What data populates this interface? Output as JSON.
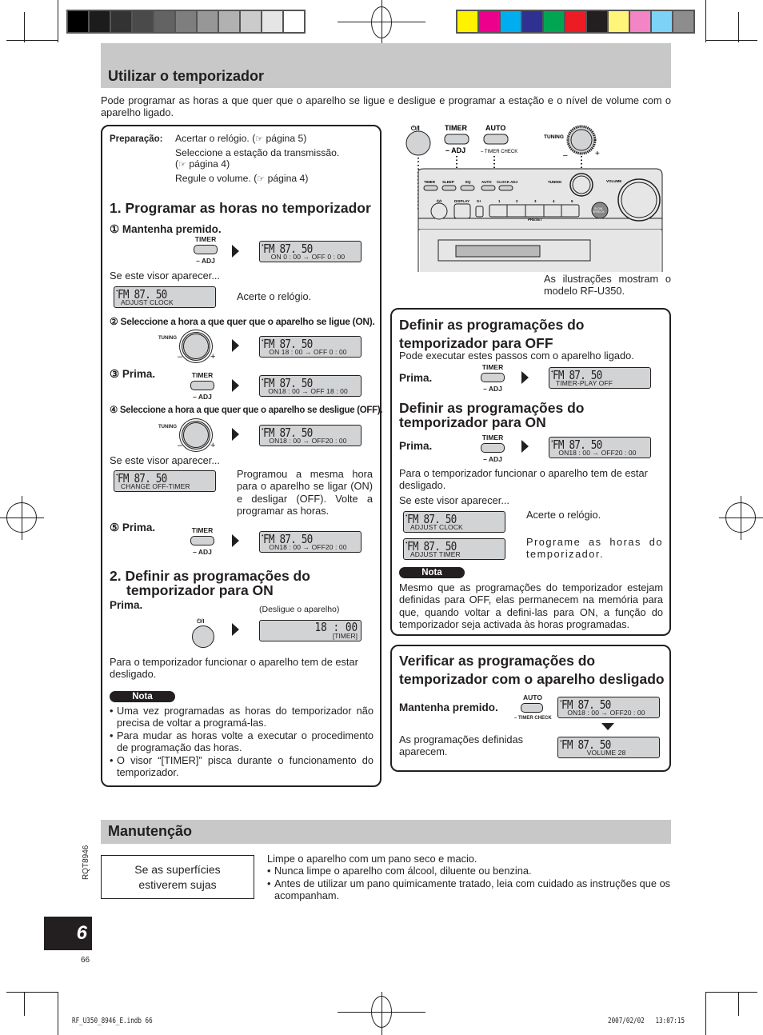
{
  "print_marks": {
    "grayscale_swatches": [
      "#000000",
      "#1c1c1c",
      "#333333",
      "#4a4a4a",
      "#636363",
      "#7e7e7e",
      "#979797",
      "#b1b1b1",
      "#cbcbcb",
      "#e5e5e5",
      "#ffffff"
    ],
    "color_swatches": [
      "#fff200",
      "#ec008c",
      "#00aeef",
      "#2e3192",
      "#00a651",
      "#ed1c24",
      "#231f20",
      "#fff57a",
      "#f384c6",
      "#7dd3f7",
      "#8e8d8e"
    ],
    "file_name": "RF_U350_8946_E.indb   66",
    "timestamp": "2007/02/02   13:07:15"
  },
  "side": {
    "doc_code": "RQT8946",
    "chapter_number": "6",
    "page_number": "66"
  },
  "timer_section": {
    "title": "Utilizar o temporizador",
    "intro": "Pode programar as horas a que quer que o aparelho se ligue e desligue e programar a estação e o nível de volume com o aparelho ligado.",
    "preparation": {
      "label": "Preparação:",
      "items": [
        {
          "text": "Acertar o relógio. (",
          "ref": "página 5)"
        },
        {
          "text": "Seleccione a estação da transmissão.",
          "text2": "(",
          "ref": "página 4)"
        },
        {
          "text": "Regule o volume. (",
          "ref": "página 4)"
        }
      ]
    },
    "part1": {
      "title": "1. Programar as horas no temporizador",
      "step1": "① Mantenha premido.",
      "if_display": "Se este visor aparecer...",
      "adjust_clock_hint": "Acerte o relógio.",
      "step2": "② Seleccione a hora a que quer que o aparelho se ligue (ON).",
      "step3": "③ Prima.",
      "step4": "④ Seleccione a hora a que quer que o aparelho se desligue (OFF).",
      "if_display2": "Se este visor aparecer...",
      "same_time_hint": "Programou a mesma hora para o aparelho se ligar (ON) e desligar (OFF). Volte a programar as horas.",
      "step5": "⑤ Prima."
    },
    "part2": {
      "title_line1": "2. Definir as programações do",
      "title_line2": "temporizador para ON",
      "press": "Prima.",
      "power_off_hint": "(Desligue o aparelho)",
      "must_be_off": "Para o temporizador funcionar o aparelho tem de estar desligado.",
      "note_label": "Nota",
      "notes": [
        "Uma vez programadas as horas do temporizador não precisa de voltar a programá-las.",
        "Para mudar as horas volte a executar o procedimento de programação das horas.",
        "O visor “[TIMER]” pisca durante o funcionamento do temporizador."
      ]
    },
    "illustration": {
      "power_label": "⏻/I",
      "timer_label": "TIMER",
      "adj_label": "– ADJ",
      "auto_label": "AUTO",
      "timer_check_label": "– TIMER CHECK",
      "tuning_label": "TUNING",
      "volume_label": "VOLUME",
      "panel_buttons": [
        "TIMER",
        "SLEEP",
        "EQ",
        "AUTO",
        "CLOCK ADJ"
      ],
      "display_label": "DISPLAY",
      "s_plus_label": "S+",
      "presets": [
        "1",
        "2",
        "3",
        "4",
        "5"
      ],
      "preset_label": "PRESET",
      "slow_speech": "SLOW SPEECH",
      "caption": "As ilustrações mostram o modelo RF-U350."
    },
    "off_box": {
      "title_line1": "Definir as programações do",
      "title_line2": "temporizador para OFF",
      "subtitle": "Pode executar estes passos com o aparelho ligado.",
      "press": "Prima.",
      "on_title_line1": "Definir as programações do",
      "on_title_line2": "temporizador para ON",
      "on_press": "Prima.",
      "must_be_off": "Para o temporizador funcionar o aparelho tem de estar desligado.",
      "if_display": "Se este visor aparecer...",
      "adjust_clock_hint": "Acerte o relógio.",
      "adjust_timer_hint": "Programe as horas do temporizador.",
      "note_label": "Nota",
      "note": "Mesmo que as programações do temporizador estejam definidas para OFF, elas permanecem na memória para que, quando voltar a defini-las para ON, a função do temporizador seja activada às horas programadas."
    },
    "check_box": {
      "title_line1": "Verificar as programações do",
      "title_line2": "temporizador com o aparelho desligado",
      "hold": "Mantenha premido.",
      "shown": "As programações definidas aparecem."
    },
    "displays": {
      "freq": "FM  87. 50",
      "d1_line2": "ON   0 : 00 → OFF  0 : 00",
      "adjust_clock": "ADJUST CLOCK",
      "d2_line2": "ON  18 : 00 → OFF  0 : 00",
      "d3_line2": "ON18 : 00 → OFF 18 : 00",
      "d4_line2": "ON18 : 00 → OFF20 : 00",
      "change_off_timer": "CHANGE  OFF-TIMER",
      "standby_time": "18 : 00",
      "standby_timer": "[TIMER]",
      "timer_play_off": "TIMER-PLAY  OFF",
      "adjust_timer": "ADJUST  TIMER",
      "volume": "VOLUME 28"
    },
    "buttons": {
      "timer": "TIMER",
      "adj": "– ADJ",
      "tuning": "TUNING",
      "auto": "AUTO",
      "timer_check": "– TIMER CHECK",
      "power": "⏻/I",
      "minus": "–",
      "plus": "+"
    }
  },
  "maintenance": {
    "title": "Manutenção",
    "condition": "Se as superfícies estiverem sujas",
    "intro": "Limpe o aparelho com um pano seco e macio.",
    "bullets": [
      "Nunca limpe o aparelho com álcool, diluente ou benzina.",
      "Antes de utilizar um pano quimicamente tratado, leia com cuidado as instruções que os acompanham."
    ]
  }
}
